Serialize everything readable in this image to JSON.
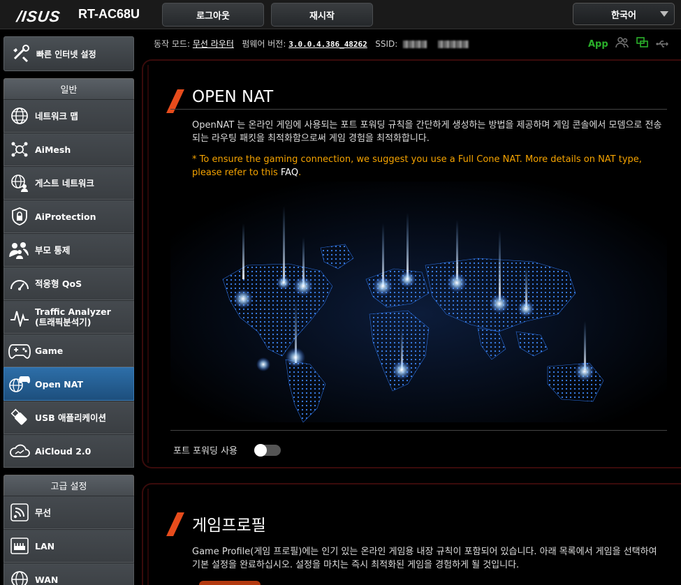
{
  "header": {
    "brand": "/ISUS",
    "model": "RT-AC68U",
    "logout_label": "로그아웃",
    "reboot_label": "재시작",
    "language": "한국어"
  },
  "status": {
    "mode_label": "동작 모드:",
    "mode_value": "무선 라우터",
    "firmware_label": "펌웨어 버전:",
    "firmware_value": "3.0.0.4.386_48262",
    "ssid_label": "SSID:",
    "app_label": "App"
  },
  "sidebar": {
    "quick_setup": "빠른 인터넷 설정",
    "general_header": "일반",
    "general_items": [
      {
        "label": "네트워크 맵",
        "icon": "globe-network-icon"
      },
      {
        "label": "AiMesh",
        "icon": "mesh-icon"
      },
      {
        "label": "게스트 네트워크",
        "icon": "guest-network-icon"
      },
      {
        "label": "AiProtection",
        "icon": "shield-lock-icon"
      },
      {
        "label": "부모 통제",
        "icon": "family-icon"
      },
      {
        "label": "적응형 QoS",
        "icon": "speedometer-icon"
      },
      {
        "label": "Traffic Analyzer",
        "label2": "(트래픽분석기)",
        "icon": "traffic-analyzer-icon"
      },
      {
        "label": "Game",
        "icon": "gamepad-icon"
      },
      {
        "label": "Open NAT",
        "icon": "open-nat-icon"
      },
      {
        "label": "USB 애플리케이션",
        "icon": "usb-icon"
      },
      {
        "label": "AiCloud 2.0",
        "icon": "cloud-icon"
      }
    ],
    "advanced_header": "고급 설정",
    "advanced_items": [
      {
        "label": "무선",
        "icon": "wireless-icon"
      },
      {
        "label": "LAN",
        "icon": "lan-icon"
      },
      {
        "label": "WAN",
        "icon": "wan-icon"
      }
    ]
  },
  "open_nat": {
    "title": "OPEN NAT",
    "description": "OpenNAT 는 온라인 게임에 사용되는 포트 포워딩 규칙을 간단하게 생성하는 방법을 제공하며 게임 콘솔에서 모뎀으로 전송되는 라우팅 패킷을 최적화함으로써 게임 경험을 최적화합니다.",
    "note": "* To ensure the gaming connection, we suggest you use a Full Cone NAT. More details on NAT type, please refer to this ",
    "note_link": "FAQ",
    "note_end": ".",
    "toggle_label": "포트 포워딩 사용",
    "toggle_on": false
  },
  "game_profile": {
    "title": "게임프로필",
    "description": "Game Profile(게임 프로필)에는 인기 있는 온라인 게임용 내장 규칙이 포함되어 있습니다. 아래 목록에서 게임을 선택하여 기본 설정을 완료하십시오. 설정을 마치는 즉시 최적화된 게임을 경험하게 될 것입니다."
  },
  "colors": {
    "accent": "#e74c1c",
    "note": "#f5a300",
    "active_menu": "#2d6ea8",
    "app_green": "#2ab02a"
  }
}
